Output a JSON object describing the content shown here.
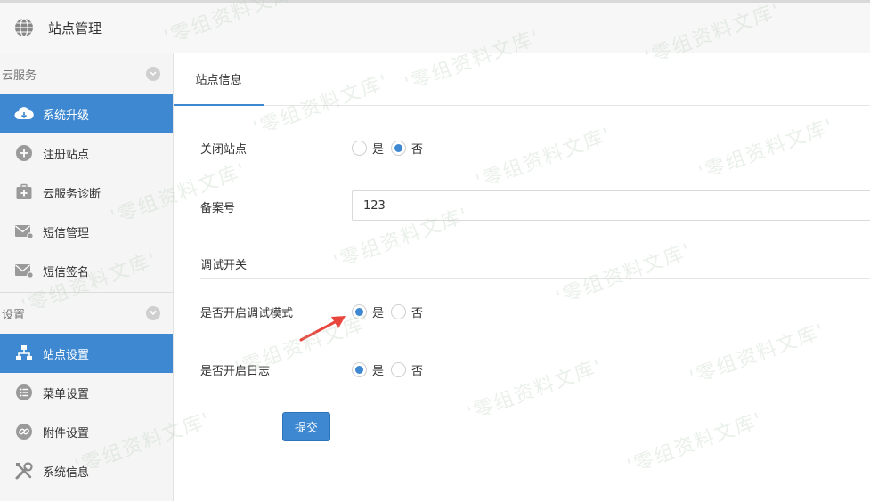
{
  "header": {
    "title": "站点管理"
  },
  "sidebar": {
    "groups": [
      {
        "title": "云服务",
        "items": [
          {
            "label": "系统升级",
            "icon": "cloud-download-icon",
            "active": true
          },
          {
            "label": "注册站点",
            "icon": "plus-circle-icon",
            "active": false
          },
          {
            "label": "云服务诊断",
            "icon": "medical-kit-icon",
            "active": false
          },
          {
            "label": "短信管理",
            "icon": "envelope-icon",
            "active": false
          },
          {
            "label": "短信签名",
            "icon": "envelope-icon",
            "active": false
          }
        ]
      },
      {
        "title": "设置",
        "items": [
          {
            "label": "站点设置",
            "icon": "sitemap-icon",
            "active": true
          },
          {
            "label": "菜单设置",
            "icon": "list-icon",
            "active": false
          },
          {
            "label": "附件设置",
            "icon": "link-icon",
            "active": false
          },
          {
            "label": "系统信息",
            "icon": "tools-icon",
            "active": false
          }
        ]
      }
    ]
  },
  "main": {
    "tab": "站点信息",
    "form": {
      "close_site": {
        "label": "关闭站点",
        "options": [
          "是",
          "否"
        ],
        "selected": "否"
      },
      "icp": {
        "label": "备案号",
        "value": "123"
      },
      "debug_section": "调试开关",
      "debug_mode": {
        "label": "是否开启调试模式",
        "options": [
          "是",
          "否"
        ],
        "selected": "是"
      },
      "enable_log": {
        "label": "是否开启日志",
        "options": [
          "是",
          "否"
        ],
        "selected": "是"
      },
      "submit": "提交"
    }
  },
  "watermark": "'零组资料文库'",
  "colors": {
    "accent": "#3d88d1",
    "arrow": "#e8453c"
  }
}
